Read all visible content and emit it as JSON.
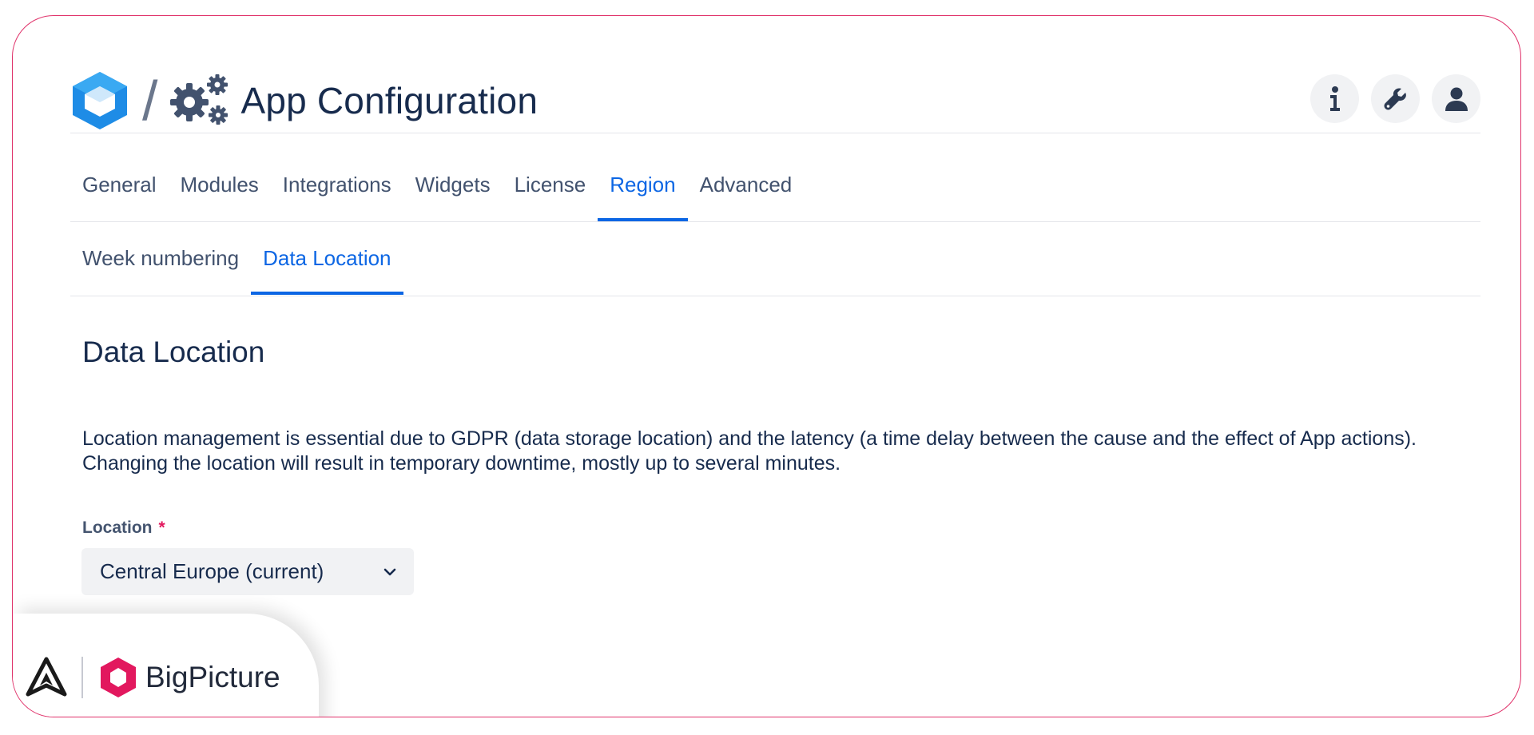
{
  "header": {
    "title": "App Configuration",
    "separator": "/",
    "icons": [
      "app-logo-icon",
      "gears-icon",
      "info-icon",
      "wrench-icon",
      "user-icon"
    ]
  },
  "tabs": [
    {
      "label": "General",
      "active": false
    },
    {
      "label": "Modules",
      "active": false
    },
    {
      "label": "Integrations",
      "active": false
    },
    {
      "label": "Widgets",
      "active": false
    },
    {
      "label": "License",
      "active": false
    },
    {
      "label": "Region",
      "active": true
    },
    {
      "label": "Advanced",
      "active": false
    }
  ],
  "subtabs": [
    {
      "label": "Week numbering",
      "active": false
    },
    {
      "label": "Data Location",
      "active": true
    }
  ],
  "section": {
    "title": "Data Location",
    "description_line1": "Location management is essential due to GDPR (data storage location) and the latency (a time delay between the cause and the effect of App actions).",
    "description_line2": "Changing the location will result in temporary downtime, mostly up to several minutes."
  },
  "location_field": {
    "label": "Location",
    "required_mark": "*",
    "selected_value": "Central Europe (current)"
  },
  "branding": {
    "name": "BigPicture"
  },
  "colors": {
    "accent": "#0c66e4",
    "frame_border": "#e0336b",
    "required": "#e2185e",
    "brand": "#e2185e"
  }
}
